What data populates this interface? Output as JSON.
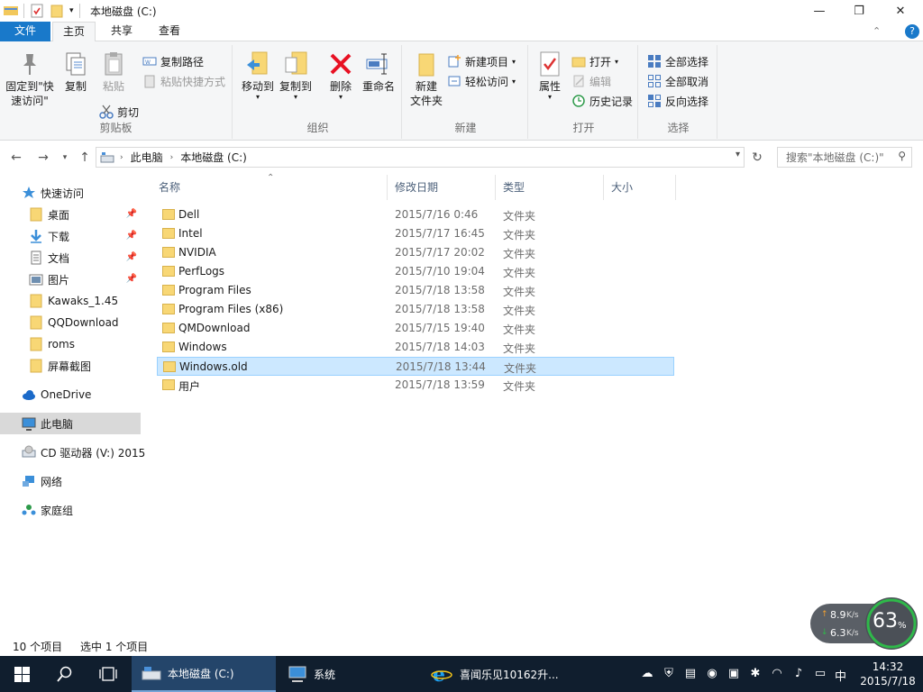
{
  "window": {
    "title": "本地磁盘 (C:)",
    "minimize": "—",
    "maximize": "❐",
    "close": "✕",
    "help": "?"
  },
  "tabs": {
    "file": "文件",
    "home": "主页",
    "share": "共享",
    "view": "查看"
  },
  "ribbon": {
    "clipboard": {
      "label": "剪贴板",
      "pin": [
        "固定到\"快",
        "速访问\""
      ],
      "copy": "复制",
      "paste": "粘贴",
      "copy_path": "复制路径",
      "paste_shortcut": "粘贴快捷方式",
      "cut": "剪切"
    },
    "organize": {
      "label": "组织",
      "move_to": "移动到",
      "copy_to": "复制到",
      "delete": "删除",
      "rename": "重命名"
    },
    "new": {
      "label": "新建",
      "new_folder": [
        "新建",
        "文件夹"
      ],
      "new_item": "新建项目",
      "easy_access": "轻松访问"
    },
    "open": {
      "label": "打开",
      "properties": "属性",
      "open": "打开",
      "edit": "编辑",
      "history": "历史记录"
    },
    "select": {
      "label": "选择",
      "select_all": "全部选择",
      "select_none": "全部取消",
      "invert": "反向选择"
    }
  },
  "address": {
    "crumbs": [
      "此电脑",
      "本地磁盘 (C:)"
    ],
    "search_placeholder": "搜索\"本地磁盘 (C:)\""
  },
  "navpane": {
    "quick_access": "快速访问",
    "pinned": [
      "桌面",
      "下载",
      "文档",
      "图片"
    ],
    "recent": [
      "Kawaks_1.45",
      "QQDownload",
      "roms",
      "屏幕截图"
    ],
    "onedrive": "OneDrive",
    "this_pc": "此电脑",
    "cd_drive": "CD 驱动器 (V:) 2015",
    "network": "网络",
    "homegroup": "家庭组"
  },
  "columns": {
    "name": "名称",
    "date": "修改日期",
    "type": "类型",
    "size": "大小"
  },
  "files": [
    {
      "name": "Dell",
      "date": "2015/7/16 0:46",
      "type": "文件夹"
    },
    {
      "name": "Intel",
      "date": "2015/7/17 16:45",
      "type": "文件夹"
    },
    {
      "name": "NVIDIA",
      "date": "2015/7/17 20:02",
      "type": "文件夹"
    },
    {
      "name": "PerfLogs",
      "date": "2015/7/10 19:04",
      "type": "文件夹"
    },
    {
      "name": "Program Files",
      "date": "2015/7/18 13:58",
      "type": "文件夹"
    },
    {
      "name": "Program Files (x86)",
      "date": "2015/7/18 13:58",
      "type": "文件夹"
    },
    {
      "name": "QMDownload",
      "date": "2015/7/15 19:40",
      "type": "文件夹"
    },
    {
      "name": "Windows",
      "date": "2015/7/18 14:03",
      "type": "文件夹"
    },
    {
      "name": "Windows.old",
      "date": "2015/7/18 13:44",
      "type": "文件夹",
      "selected": true
    },
    {
      "name": "用户",
      "date": "2015/7/18 13:59",
      "type": "文件夹"
    }
  ],
  "status": {
    "count": "10 个项目",
    "selected": "选中 1 个项目"
  },
  "speed": {
    "up": "8.9",
    "down": "6.3",
    "unit": "K/s",
    "percent": "63",
    "percent_sign": "%"
  },
  "taskbar": {
    "explorer": "本地磁盘 (C:)",
    "system": "系统",
    "ie": "喜闻乐见10162升...",
    "ime": "中",
    "time": "14:32",
    "date": "2015/7/18"
  },
  "colors": {
    "accent": "#1979ca",
    "selection": "#cce8ff",
    "folder": "#f8d775",
    "taskbar": "#101e2e",
    "delete_red": "#e81123"
  }
}
